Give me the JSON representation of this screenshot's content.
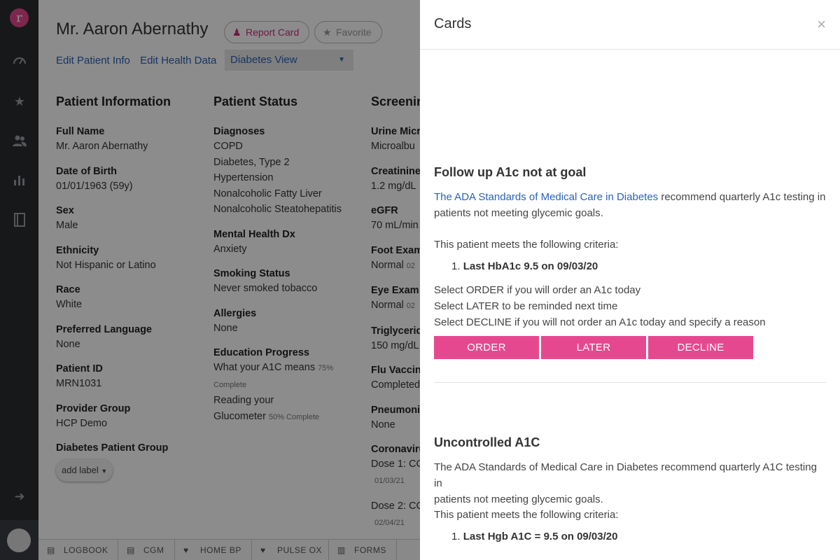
{
  "rail": {
    "logo_letter": "r",
    "icons": [
      "dashboard-icon",
      "star-icon",
      "users-icon",
      "bar-chart-icon",
      "book-icon",
      "arrow-right-icon"
    ]
  },
  "patient": {
    "title": "Mr. Aaron Abernathy",
    "report_card": "Report Card",
    "favorite": "Favorite",
    "edit_info": "Edit Patient Info",
    "edit_health": "Edit Health Data",
    "view": "Diabetes View"
  },
  "info": {
    "heading": "Patient Information",
    "fields": [
      {
        "label": "Full Name",
        "value": "Mr. Aaron Abernathy"
      },
      {
        "label": "Date of Birth",
        "value": "01/01/1963 (59y)"
      },
      {
        "label": "Sex",
        "value": "Male"
      },
      {
        "label": "Ethnicity",
        "value": "Not Hispanic or Latino"
      },
      {
        "label": "Race",
        "value": "White"
      },
      {
        "label": "Preferred Language",
        "value": "None"
      },
      {
        "label": "Patient ID",
        "value": "MRN1031"
      },
      {
        "label": "Provider Group",
        "value": "HCP Demo"
      },
      {
        "label": "Diabetes Patient Group",
        "value": ""
      }
    ],
    "add_label": "add label"
  },
  "status": {
    "heading": "Patient Status",
    "diagnoses_label": "Diagnoses",
    "diagnoses": [
      "COPD",
      "Diabetes, Type 2",
      "Hypertension",
      "Nonalcoholic Fatty Liver",
      "Nonalcoholic Steatohepatitis"
    ],
    "mental_label": "Mental Health Dx",
    "mental": "Anxiety",
    "smoking_label": "Smoking Status",
    "smoking": "Never smoked tobacco",
    "allergies_label": "Allergies",
    "allergies": "None",
    "education_label": "Education Progress",
    "edu1": "What your A1C means",
    "edu1_pct": "75%",
    "edu1_done": "Complete",
    "edu2a": "Reading your",
    "edu2b": "Glucometer",
    "edu2_pct": "50% Complete"
  },
  "screening": {
    "heading": "Screenin",
    "items": [
      {
        "label": "Urine Micr",
        "value": "Microalbu"
      },
      {
        "label": "Creatinine",
        "value": "1.2 mg/dL"
      },
      {
        "label": "eGFR",
        "value": "70 mL/min"
      },
      {
        "label": "Foot Exam",
        "value": "Normal",
        "date": "02"
      },
      {
        "label": "Eye Exam",
        "value": "Normal",
        "date": "02"
      },
      {
        "label": "Triglycerid",
        "value": "150 mg/dL"
      },
      {
        "label": "Flu Vaccine",
        "value": "Completed"
      },
      {
        "label": "Pneumonia",
        "value": "None"
      },
      {
        "label": "Coronaviru",
        "value": "Dose 1: CO",
        "date": "01/03/21"
      },
      {
        "label": "",
        "value": "Dose 2: CO",
        "date": "02/04/21"
      }
    ]
  },
  "bottombar": [
    "LOGBOOK",
    "CGM",
    "HOME BP",
    "PULSE OX",
    "FORMS"
  ],
  "panel": {
    "title": "Cards",
    "close": "×",
    "card1": {
      "title": "Follow up A1c not at goal",
      "link": "The ADA Standards of Medical Care in Diabetes",
      "text_a": " recommend quarterly A1c testing in",
      "text_b": "patients not meeting glycemic goals.",
      "criteria_intro": "This patient meets the following criteria:",
      "criteria_num": "1.",
      "criteria": "Last HbA1c 9.5 on 09/03/20",
      "inst1": "Select ORDER if you will order an A1c today",
      "inst2": "Select LATER to be reminded next time",
      "inst3": "Select DECLINE if you will not order an A1c today and specify a reason",
      "btn_order": "ORDER",
      "btn_later": "LATER",
      "btn_decline": "DECLINE"
    },
    "card2": {
      "title": "Uncontrolled A1C",
      "text_a": "The ADA Standards of Medical Care in Diabetes recommend quarterly A1C testing in",
      "text_b": "patients not meeting glycemic goals.",
      "criteria_intro": "This patient meets the following criteria:",
      "criteria_num": "1.",
      "criteria": "Last Hgb A1C = 9.5 on 09/03/20"
    }
  },
  "colors": {
    "accent": "#e6488f",
    "link": "#2a62b8",
    "rail": "#2b2d31"
  }
}
